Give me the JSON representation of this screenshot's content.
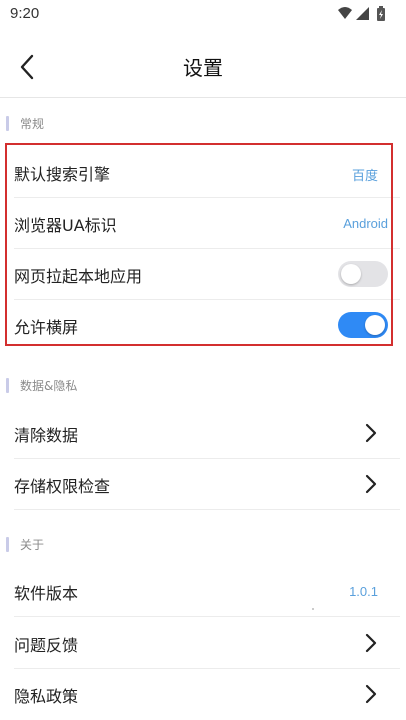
{
  "status_bar": {
    "time": "9:20"
  },
  "header": {
    "title": "设置"
  },
  "sections": {
    "general": {
      "label": "常规",
      "search_engine": {
        "label": "默认搜索引擎",
        "value": "百度"
      },
      "browser_ua": {
        "label": "浏览器UA标识",
        "value": "Android"
      },
      "open_local_app": {
        "label": "网页拉起本地应用",
        "enabled": false
      },
      "allow_landscape": {
        "label": "允许横屏",
        "enabled": true
      }
    },
    "data_privacy": {
      "label": "数据&隐私",
      "clear_data": {
        "label": "清除数据"
      },
      "storage_check": {
        "label": "存储权限检查"
      }
    },
    "about": {
      "label": "关于",
      "version": {
        "label": "软件版本",
        "value": "1.0.1"
      },
      "feedback": {
        "label": "问题反馈"
      },
      "privacy_policy": {
        "label": "隐私政策"
      }
    }
  },
  "colors": {
    "accent_blue": "#2f8af5",
    "value_blue": "#5aa0dc",
    "highlight_red": "#d32f2f",
    "section_bar": "#c9cbe8"
  },
  "icons": {
    "back": "chevron-left-icon",
    "row_arrow": "chevron-right-icon",
    "wifi": "wifi-icon",
    "signal": "signal-icon",
    "battery": "battery-icon"
  }
}
